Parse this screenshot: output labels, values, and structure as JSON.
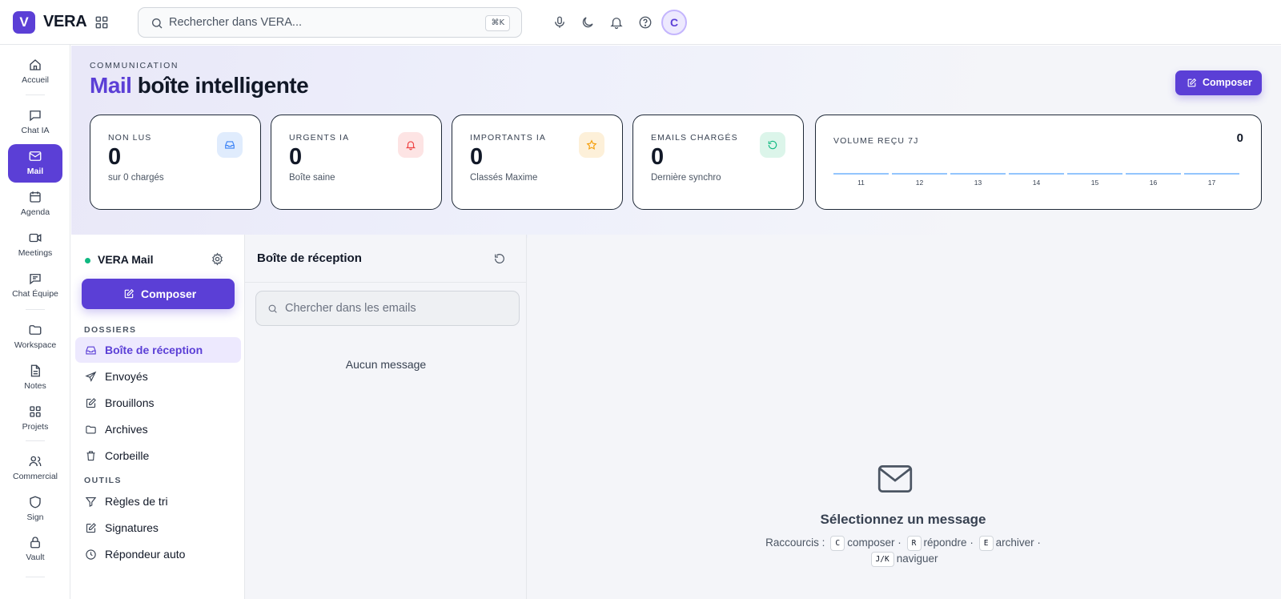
{
  "app": {
    "logo_letter": "V",
    "brand": "VERA"
  },
  "search": {
    "placeholder": "Rechercher dans VERA...",
    "shortcut": "⌘K"
  },
  "user": {
    "initial": "C"
  },
  "rail": {
    "items": [
      {
        "label": "Accueil",
        "icon": "home-icon"
      },
      {
        "label": "Chat IA",
        "icon": "chat-icon"
      },
      {
        "label": "Mail",
        "icon": "mail-icon",
        "active": true
      },
      {
        "label": "Agenda",
        "icon": "calendar-icon"
      },
      {
        "label": "Meetings",
        "icon": "video-icon"
      },
      {
        "label": "Chat Équipe",
        "icon": "team-chat-icon"
      },
      {
        "label": "Workspace",
        "icon": "folder-icon"
      },
      {
        "label": "Notes",
        "icon": "note-icon"
      },
      {
        "label": "Projets",
        "icon": "grid-icon"
      },
      {
        "label": "Commercial",
        "icon": "users-icon"
      },
      {
        "label": "Sign",
        "icon": "shield-icon"
      },
      {
        "label": "Vault",
        "icon": "lock-icon"
      }
    ]
  },
  "header": {
    "eyebrow": "COMMUNICATION",
    "title_accent": "Mail",
    "title_rest": "boîte intelligente",
    "compose_label": "Composer"
  },
  "stats": [
    {
      "key": "NON LUS",
      "value": "0",
      "sub": "sur 0 chargés",
      "icon": "inbox-icon",
      "color": "#3b82f6"
    },
    {
      "key": "URGENTS IA",
      "value": "0",
      "sub": "Boîte saine",
      "icon": "bell-icon",
      "color": "#ef4444"
    },
    {
      "key": "IMPORTANTS IA",
      "value": "0",
      "sub": "Classés Maxime",
      "icon": "star-icon",
      "color": "#f59e0b"
    },
    {
      "key": "EMAILS CHARGÉS",
      "value": "0",
      "sub": "Dernière synchro",
      "icon": "refresh-icon",
      "color": "#10b981"
    }
  ],
  "volume": {
    "key": "VOLUME REÇU 7J",
    "total": "0",
    "chart_data": {
      "type": "bar",
      "categories": [
        "11",
        "12",
        "13",
        "14",
        "15",
        "16",
        "17"
      ],
      "values": [
        0,
        0,
        0,
        0,
        0,
        0,
        0
      ]
    }
  },
  "mail_sidebar": {
    "title": "VERA Mail",
    "compose_label": "Composer",
    "folders_title": "DOSSIERS",
    "folders": [
      {
        "label": "Boîte de réception",
        "icon": "inbox-icon",
        "active": true
      },
      {
        "label": "Envoyés",
        "icon": "send-icon"
      },
      {
        "label": "Brouillons",
        "icon": "edit-icon"
      },
      {
        "label": "Archives",
        "icon": "folder-icon"
      },
      {
        "label": "Corbeille",
        "icon": "trash-icon"
      }
    ],
    "tools_title": "OUTILS",
    "tools": [
      {
        "label": "Règles de tri",
        "icon": "filter-icon"
      },
      {
        "label": "Signatures",
        "icon": "edit-icon"
      },
      {
        "label": "Répondeur auto",
        "icon": "clock-icon"
      }
    ]
  },
  "list": {
    "title": "Boîte de réception",
    "search_placeholder": "Chercher dans les emails",
    "empty": "Aucun message"
  },
  "reader": {
    "title": "Sélectionnez un message",
    "shortcuts_prefix": "Raccourcis :",
    "shortcuts": [
      {
        "key": "C",
        "label": "composer"
      },
      {
        "key": "R",
        "label": "répondre"
      },
      {
        "key": "E",
        "label": "archiver"
      },
      {
        "key": "J/K",
        "label": "naviguer"
      }
    ],
    "separator": "·"
  }
}
